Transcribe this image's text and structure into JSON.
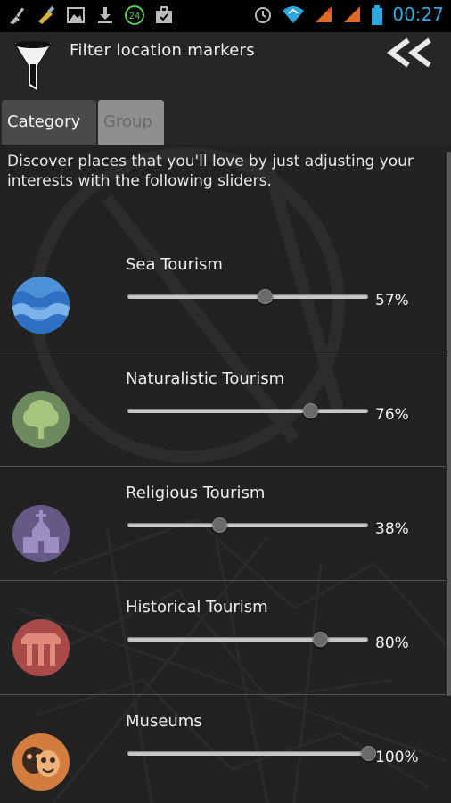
{
  "status_bar": {
    "time": "00:27",
    "icons": [
      "broom-icon",
      "paint-icon",
      "image-icon",
      "download-icon",
      "24-badge-icon",
      "briefcase-icon",
      "alarm-icon",
      "wifi-icon",
      "signal-icon",
      "battery-icon"
    ]
  },
  "header": {
    "title": "Filter location markers",
    "filter_icon": "funnel-icon",
    "back_icon": "double-chevron-left-icon"
  },
  "tabs": [
    {
      "label": "Category",
      "active": true
    },
    {
      "label": "Group",
      "active": false
    }
  ],
  "intro_text": "Discover places that you'll love by just adjusting your interests with the following sliders.",
  "categories": [
    {
      "label": "Sea Tourism",
      "value": 57,
      "value_text": "57%",
      "icon": "waves-icon",
      "color": "#4d92d9"
    },
    {
      "label": "Naturalistic Tourism",
      "value": 76,
      "value_text": "76%",
      "icon": "tree-icon",
      "color": "#6d8a5e"
    },
    {
      "label": "Religious Tourism",
      "value": 38,
      "value_text": "38%",
      "icon": "church-icon",
      "color": "#655a86"
    },
    {
      "label": "Historical Tourism",
      "value": 80,
      "value_text": "80%",
      "icon": "temple-column-icon",
      "color": "#a84a48"
    },
    {
      "label": "Museums",
      "value": 100,
      "value_text": "100%",
      "icon": "theatre-masks-icon",
      "color": "#d27d3e"
    }
  ]
}
